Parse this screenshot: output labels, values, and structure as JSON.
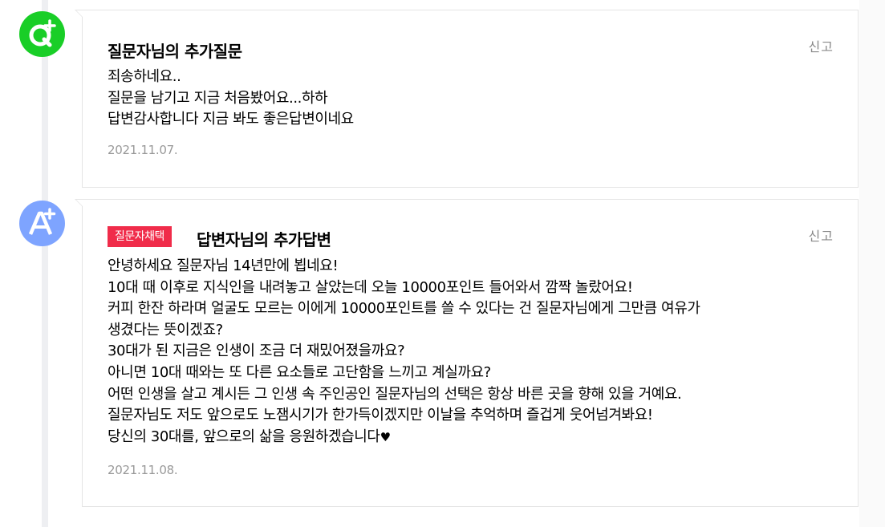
{
  "question_card": {
    "title": "질문자님의 추가질문",
    "report_label": "신고",
    "lines": [
      "죄송하네요..",
      "질문을 남기고 지금 처음봤어요...하하",
      "답변감사합니다 지금 봐도 좋은답변이네요"
    ],
    "date": "2021.11.07.",
    "avatar_icon": "question-plus-icon",
    "avatar_color": "#19ce27"
  },
  "answer_card": {
    "badge": "질문자채택",
    "badge_color": "#f02c4a",
    "title": "답변자님의 추가답변",
    "report_label": "신고",
    "lines": [
      "안녕하세요 질문자님 14년만에 뵙네요!",
      "10대 때 이후로 지식인을 내려놓고 살았는데 오늘 10000포인트 들어와서 깜짝 놀랐어요!",
      "커피 한잔 하라며 얼굴도 모르는 이에게 10000포인트를 쓸 수 있다는 건 질문자님에게 그만큼 여유가",
      "생겼다는 뜻이겠죠?",
      "30대가 된 지금은 인생이 조금 더 재밌어졌을까요?",
      "아니면 10대 때와는 또 다른 요소들로 고단함을 느끼고 계실까요?",
      "어떤 인생을 살고 계시든 그 인생 속 주인공인 질문자님의 선택은 항상 바른 곳을 향해 있을 거예요.",
      "질문자님도 저도 앞으로도 노잼시기가 한가득이겠지만 이날을 추억하며 즐겁게 웃어넘겨봐요!",
      "당신의 30대를, 앞으로의 삶을 응원하겠습니다"
    ],
    "heart": "♥",
    "date": "2021.11.08.",
    "avatar_icon": "answer-plus-icon",
    "avatar_color": "#7ea4ff"
  }
}
